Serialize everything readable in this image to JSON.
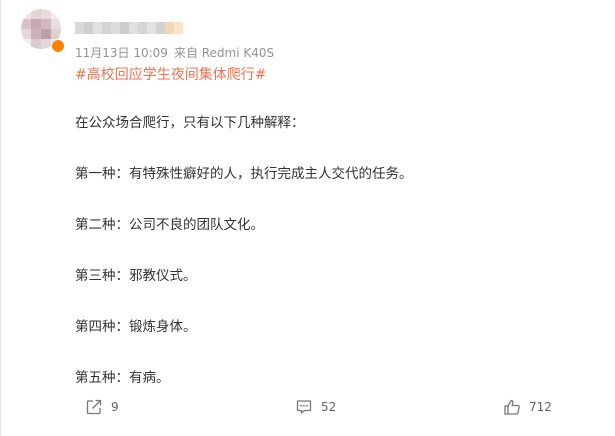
{
  "post": {
    "meta": {
      "timestamp": "11月13日 10:09",
      "source": "来自 Redmi K40S"
    },
    "topic": "#高校回应学生夜间集体爬行#",
    "paragraphs": [
      "在公众场合爬行，只有以下几种解释：",
      "第一种：有特殊性癖好的人，执行完成主人交代的任务。",
      "第二种：公司不良的团队文化。",
      "第三种：邪教仪式。",
      "第四种：锻炼身体。",
      "第五种：有病。"
    ]
  },
  "actions": {
    "share": {
      "icon": "share-icon",
      "count": "9"
    },
    "comment": {
      "icon": "comment-icon",
      "count": "52"
    },
    "like": {
      "icon": "thumbs-up-icon",
      "count": "712"
    }
  },
  "colors": {
    "topic": "#eb7350",
    "meta": "#939393",
    "text": "#333333",
    "badge": "#ff8200"
  }
}
